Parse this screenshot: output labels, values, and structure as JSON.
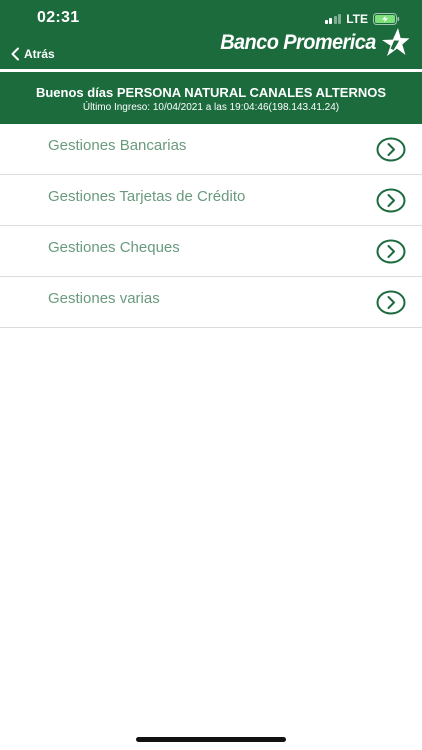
{
  "status_bar": {
    "time": "02:31",
    "network": "LTE",
    "icons": [
      "signal-icon",
      "battery-charging-icon"
    ]
  },
  "header": {
    "back_label": "Atrás",
    "back_icon": "chevron-left-icon",
    "brand": "Banco Promerica",
    "brand_icon": "star-logo-icon"
  },
  "greeting": {
    "title": "Buenos días PERSONA NATURAL CANALES ALTERNOS",
    "last_login": "Último Ingreso: 10/04/2021 a las 19:04:46(198.143.41.24)"
  },
  "menu": {
    "items": [
      {
        "label": "Gestiones Bancarias",
        "icon": "chevron-right-circle-icon"
      },
      {
        "label": "Gestiones Tarjetas de Crédito",
        "icon": "chevron-right-circle-icon"
      },
      {
        "label": "Gestiones Cheques",
        "icon": "chevron-right-circle-icon"
      },
      {
        "label": "Gestiones varias",
        "icon": "chevron-right-circle-icon"
      }
    ]
  },
  "colors": {
    "brand_green": "#1b6b3d",
    "menu_text": "#6a9a7e",
    "chevron_green": "#1b6b3d",
    "divider": "#dcdcdc"
  }
}
